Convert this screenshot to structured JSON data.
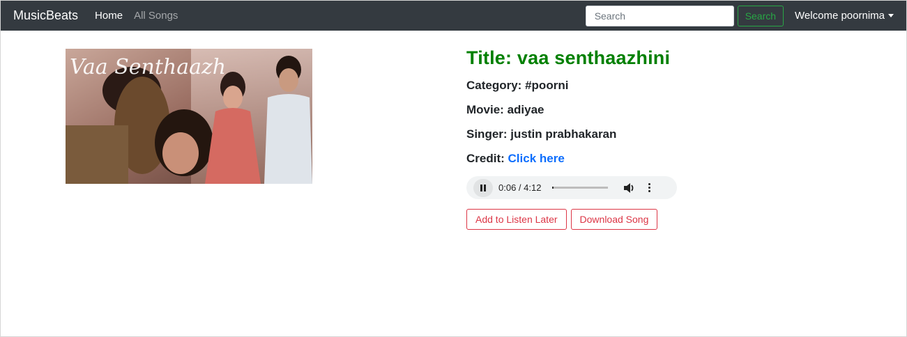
{
  "navbar": {
    "brand": "MusicBeats",
    "links": [
      {
        "label": "Home",
        "active": true
      },
      {
        "label": "All Songs",
        "active": false
      }
    ],
    "search": {
      "placeholder": "Search",
      "value": "",
      "button_label": "Search"
    },
    "user_menu_label": "Welcome poornima"
  },
  "song": {
    "title": "Title: vaa senthaazhini",
    "category_label": "Category:",
    "category": "#poorni",
    "movie_label": "Movie:",
    "movie": "adiyae",
    "singer_label": "Singer:",
    "singer": "justin prabhakaran",
    "credit_label": "Credit:",
    "credit_link": "Click here"
  },
  "player": {
    "time": "0:06 / 4:12",
    "progress": 0.024,
    "state": "playing"
  },
  "actions": {
    "listen_later": "Add to Listen Later",
    "download": "Download Song"
  },
  "colors": {
    "navbar_bg": "#343a40",
    "title_green": "#008000",
    "link_blue": "#0d6efd",
    "search_green": "#28a745",
    "action_red": "#dc3545"
  }
}
